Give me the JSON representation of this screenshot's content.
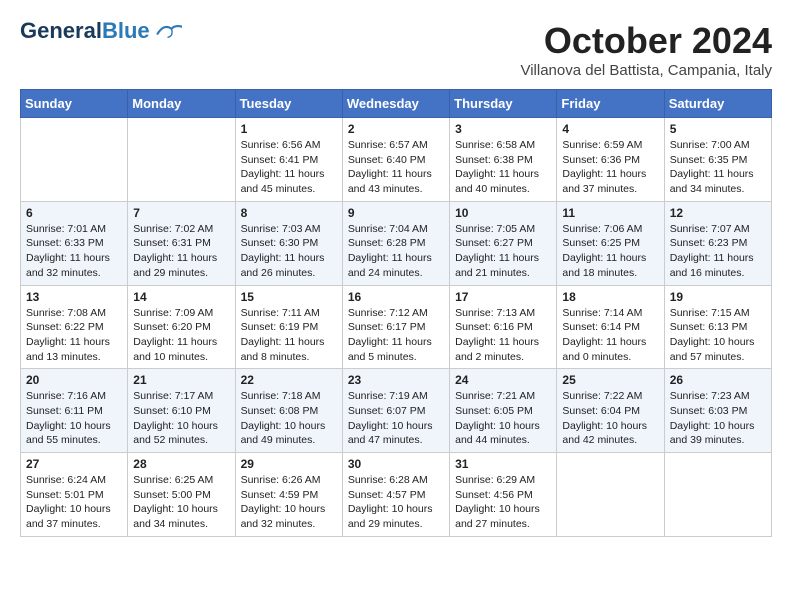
{
  "header": {
    "logo_line1": "General",
    "logo_line2": "Blue",
    "month": "October 2024",
    "location": "Villanova del Battista, Campania, Italy"
  },
  "weekdays": [
    "Sunday",
    "Monday",
    "Tuesday",
    "Wednesday",
    "Thursday",
    "Friday",
    "Saturday"
  ],
  "weeks": [
    [
      {
        "day": "",
        "info": ""
      },
      {
        "day": "",
        "info": ""
      },
      {
        "day": "1",
        "info": "Sunrise: 6:56 AM\nSunset: 6:41 PM\nDaylight: 11 hours\nand 45 minutes."
      },
      {
        "day": "2",
        "info": "Sunrise: 6:57 AM\nSunset: 6:40 PM\nDaylight: 11 hours\nand 43 minutes."
      },
      {
        "day": "3",
        "info": "Sunrise: 6:58 AM\nSunset: 6:38 PM\nDaylight: 11 hours\nand 40 minutes."
      },
      {
        "day": "4",
        "info": "Sunrise: 6:59 AM\nSunset: 6:36 PM\nDaylight: 11 hours\nand 37 minutes."
      },
      {
        "day": "5",
        "info": "Sunrise: 7:00 AM\nSunset: 6:35 PM\nDaylight: 11 hours\nand 34 minutes."
      }
    ],
    [
      {
        "day": "6",
        "info": "Sunrise: 7:01 AM\nSunset: 6:33 PM\nDaylight: 11 hours\nand 32 minutes."
      },
      {
        "day": "7",
        "info": "Sunrise: 7:02 AM\nSunset: 6:31 PM\nDaylight: 11 hours\nand 29 minutes."
      },
      {
        "day": "8",
        "info": "Sunrise: 7:03 AM\nSunset: 6:30 PM\nDaylight: 11 hours\nand 26 minutes."
      },
      {
        "day": "9",
        "info": "Sunrise: 7:04 AM\nSunset: 6:28 PM\nDaylight: 11 hours\nand 24 minutes."
      },
      {
        "day": "10",
        "info": "Sunrise: 7:05 AM\nSunset: 6:27 PM\nDaylight: 11 hours\nand 21 minutes."
      },
      {
        "day": "11",
        "info": "Sunrise: 7:06 AM\nSunset: 6:25 PM\nDaylight: 11 hours\nand 18 minutes."
      },
      {
        "day": "12",
        "info": "Sunrise: 7:07 AM\nSunset: 6:23 PM\nDaylight: 11 hours\nand 16 minutes."
      }
    ],
    [
      {
        "day": "13",
        "info": "Sunrise: 7:08 AM\nSunset: 6:22 PM\nDaylight: 11 hours\nand 13 minutes."
      },
      {
        "day": "14",
        "info": "Sunrise: 7:09 AM\nSunset: 6:20 PM\nDaylight: 11 hours\nand 10 minutes."
      },
      {
        "day": "15",
        "info": "Sunrise: 7:11 AM\nSunset: 6:19 PM\nDaylight: 11 hours\nand 8 minutes."
      },
      {
        "day": "16",
        "info": "Sunrise: 7:12 AM\nSunset: 6:17 PM\nDaylight: 11 hours\nand 5 minutes."
      },
      {
        "day": "17",
        "info": "Sunrise: 7:13 AM\nSunset: 6:16 PM\nDaylight: 11 hours\nand 2 minutes."
      },
      {
        "day": "18",
        "info": "Sunrise: 7:14 AM\nSunset: 6:14 PM\nDaylight: 11 hours\nand 0 minutes."
      },
      {
        "day": "19",
        "info": "Sunrise: 7:15 AM\nSunset: 6:13 PM\nDaylight: 10 hours\nand 57 minutes."
      }
    ],
    [
      {
        "day": "20",
        "info": "Sunrise: 7:16 AM\nSunset: 6:11 PM\nDaylight: 10 hours\nand 55 minutes."
      },
      {
        "day": "21",
        "info": "Sunrise: 7:17 AM\nSunset: 6:10 PM\nDaylight: 10 hours\nand 52 minutes."
      },
      {
        "day": "22",
        "info": "Sunrise: 7:18 AM\nSunset: 6:08 PM\nDaylight: 10 hours\nand 49 minutes."
      },
      {
        "day": "23",
        "info": "Sunrise: 7:19 AM\nSunset: 6:07 PM\nDaylight: 10 hours\nand 47 minutes."
      },
      {
        "day": "24",
        "info": "Sunrise: 7:21 AM\nSunset: 6:05 PM\nDaylight: 10 hours\nand 44 minutes."
      },
      {
        "day": "25",
        "info": "Sunrise: 7:22 AM\nSunset: 6:04 PM\nDaylight: 10 hours\nand 42 minutes."
      },
      {
        "day": "26",
        "info": "Sunrise: 7:23 AM\nSunset: 6:03 PM\nDaylight: 10 hours\nand 39 minutes."
      }
    ],
    [
      {
        "day": "27",
        "info": "Sunrise: 6:24 AM\nSunset: 5:01 PM\nDaylight: 10 hours\nand 37 minutes."
      },
      {
        "day": "28",
        "info": "Sunrise: 6:25 AM\nSunset: 5:00 PM\nDaylight: 10 hours\nand 34 minutes."
      },
      {
        "day": "29",
        "info": "Sunrise: 6:26 AM\nSunset: 4:59 PM\nDaylight: 10 hours\nand 32 minutes."
      },
      {
        "day": "30",
        "info": "Sunrise: 6:28 AM\nSunset: 4:57 PM\nDaylight: 10 hours\nand 29 minutes."
      },
      {
        "day": "31",
        "info": "Sunrise: 6:29 AM\nSunset: 4:56 PM\nDaylight: 10 hours\nand 27 minutes."
      },
      {
        "day": "",
        "info": ""
      },
      {
        "day": "",
        "info": ""
      }
    ]
  ]
}
